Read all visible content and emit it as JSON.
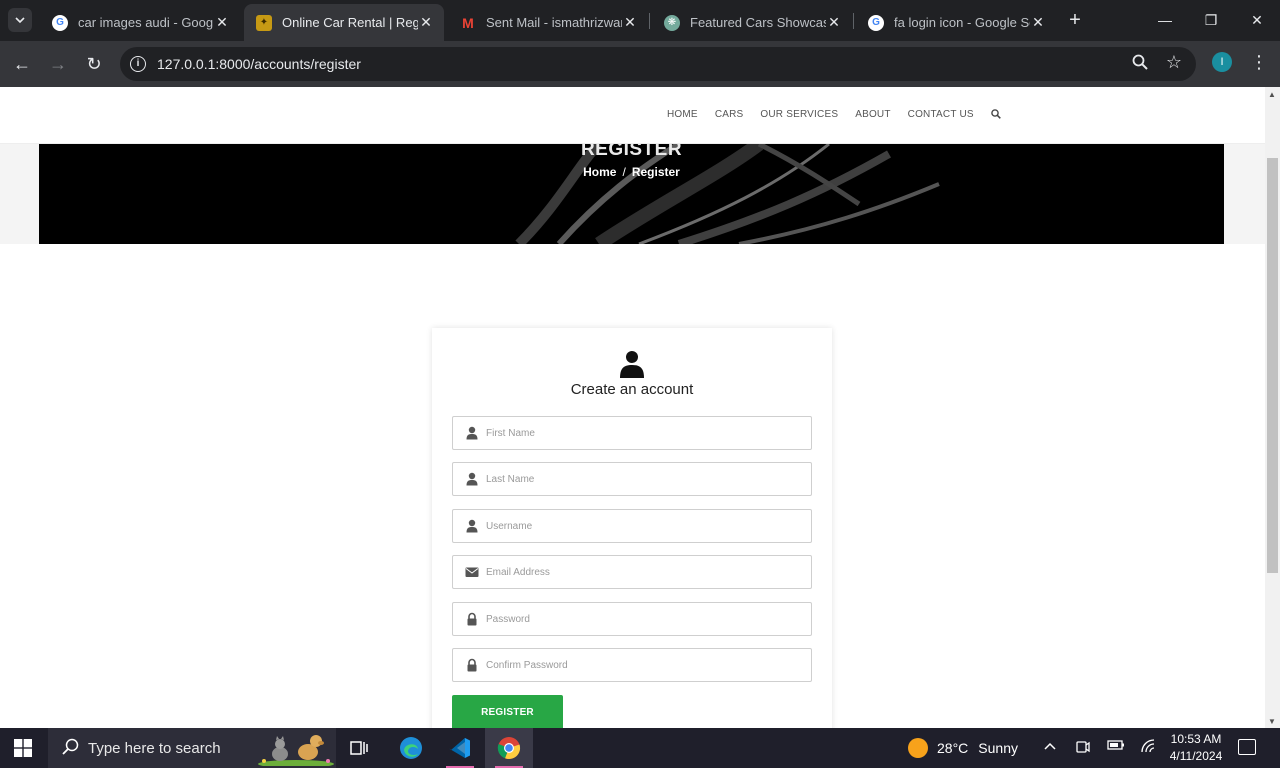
{
  "browser": {
    "tabs": [
      {
        "title": "car images audi - Google",
        "favicon": "google-icon",
        "active": false
      },
      {
        "title": "Online Car Rental | Regist",
        "favicon": "site-logo-icon",
        "active": true
      },
      {
        "title": "Sent Mail - ismathrizwana",
        "favicon": "gmail-icon",
        "active": false
      },
      {
        "title": "Featured Cars Showcase",
        "favicon": "chatgpt-icon",
        "active": false
      },
      {
        "title": "fa login icon - Google Se",
        "favicon": "google-icon",
        "active": false
      }
    ],
    "url": "127.0.0.1:8000/accounts/register",
    "profile_initial": "I"
  },
  "site": {
    "nav": [
      "HOME",
      "CARS",
      "OUR SERVICES",
      "ABOUT",
      "CONTACT US"
    ],
    "hero_title": "REGISTER",
    "breadcrumb": {
      "home": "Home",
      "separator": "/",
      "current": "Register"
    }
  },
  "form": {
    "title": "Create an account",
    "fields": [
      {
        "placeholder": "First Name",
        "icon": "user-icon",
        "value": ""
      },
      {
        "placeholder": "Last Name",
        "icon": "user-icon",
        "value": ""
      },
      {
        "placeholder": "Username",
        "icon": "user-icon",
        "value": ""
      },
      {
        "placeholder": "Email Address",
        "icon": "envelope-icon",
        "value": ""
      },
      {
        "placeholder": "Password",
        "icon": "lock-icon",
        "value": ""
      },
      {
        "placeholder": "Confirm Password",
        "icon": "lock-icon",
        "value": ""
      }
    ],
    "submit_label": "REGISTER"
  },
  "taskbar": {
    "search_placeholder": "Type here to search",
    "weather_temp": "28°C",
    "weather_desc": "Sunny",
    "time": "10:53 AM",
    "date": "4/11/2024"
  },
  "colors": {
    "accent_green": "#28a745",
    "chrome_dark": "#202124",
    "chrome_toolbar": "#35363a"
  }
}
